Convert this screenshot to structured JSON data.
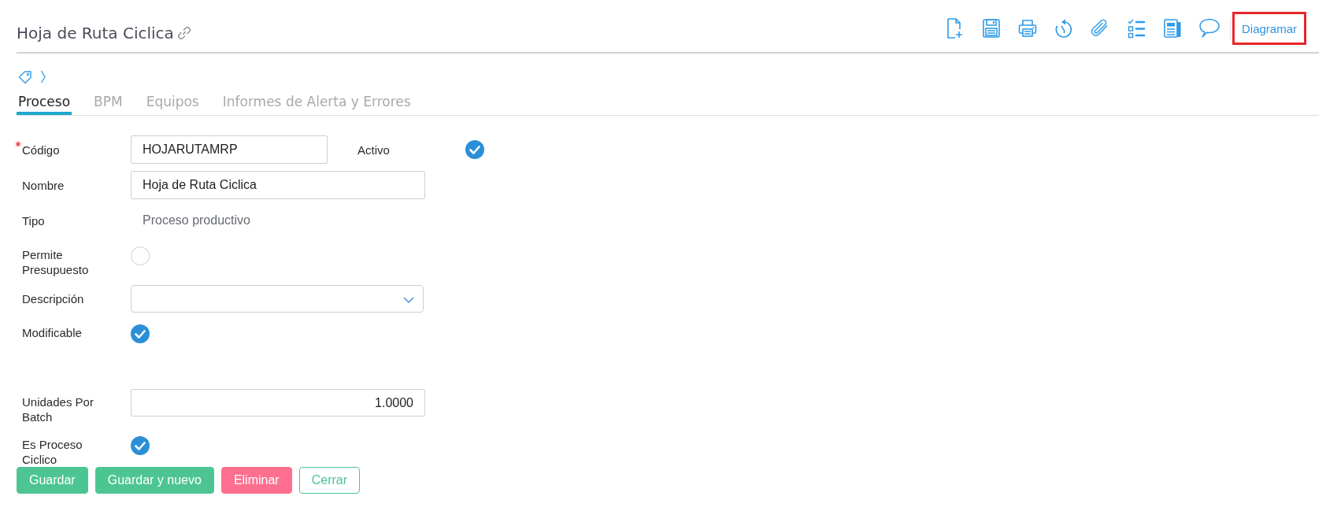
{
  "header": {
    "title": "Hoja de Ruta Ciclica",
    "diagramar": {
      "label": "Diagramar",
      "highlighted": true
    }
  },
  "tabs": [
    {
      "label": "Proceso",
      "selected": true
    },
    {
      "label": "BPM",
      "selected": false
    },
    {
      "label": "Equipos",
      "selected": false
    },
    {
      "label": "Informes de Alerta y Errores",
      "selected": false
    }
  ],
  "fields": [
    {
      "label": "Código",
      "required": true,
      "kind": "text",
      "value": "HOJARUTAMRP",
      "side": {
        "label": "Activo",
        "checked": true
      }
    },
    {
      "label": "Nombre",
      "required": false,
      "kind": "text",
      "value": "Hoja de Ruta Ciclica"
    },
    {
      "label": "Tipo",
      "required": false,
      "kind": "display",
      "value": "Proceso productivo"
    },
    {
      "label": "Permite Presupuesto",
      "required": false,
      "kind": "checkbox",
      "checked": false
    },
    {
      "label": "Descripción",
      "required": false,
      "kind": "select"
    },
    {
      "label": "Modificable",
      "required": false,
      "kind": "checkbox",
      "checked": true
    },
    {
      "label": "Unidades Por Batch",
      "required": false,
      "kind": "number",
      "value": "1.0000"
    },
    {
      "label": "Es Proceso Ciclico",
      "required": false,
      "kind": "checkbox",
      "checked": true
    }
  ],
  "buttons": [
    {
      "label": "Guardar",
      "kind": "save"
    },
    {
      "label": "Guardar y nuevo",
      "kind": "save_new"
    },
    {
      "label": "Eliminar",
      "kind": "delete"
    },
    {
      "label": "Cerrar",
      "kind": "close"
    }
  ]
}
